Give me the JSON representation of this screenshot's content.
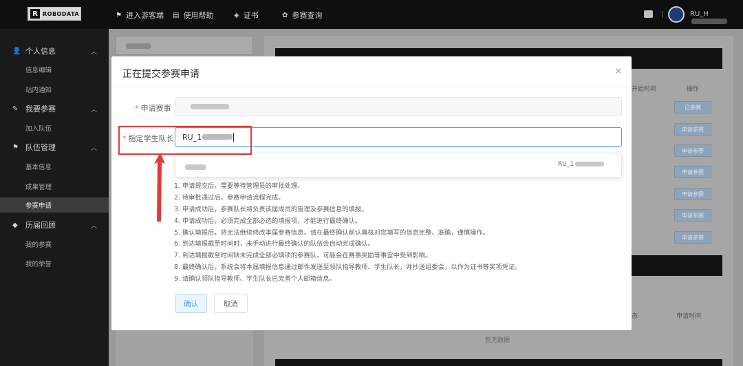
{
  "nav": {
    "logo_letter": "R",
    "logo_text": "ROBODATA",
    "items": [
      {
        "icon": "flag-icon",
        "glyph": "⚑",
        "label": "进入游客端"
      },
      {
        "icon": "book-icon",
        "glyph": "▤",
        "label": "使用帮助"
      },
      {
        "icon": "certificate-icon",
        "glyph": "◈",
        "label": "证书"
      },
      {
        "icon": "trophy-icon",
        "glyph": "✿",
        "label": "参赛查询"
      }
    ],
    "username": "RU_H"
  },
  "sidebar": {
    "groups": [
      {
        "label": "个人信息",
        "icon": "user-icon",
        "glyph": "👤",
        "items": [
          "信息编辑",
          "站内通知"
        ]
      },
      {
        "label": "我要参赛",
        "icon": "pen-icon",
        "glyph": "✎",
        "items": [
          "加入队伍"
        ]
      },
      {
        "label": "队伍管理",
        "icon": "flag-icon",
        "glyph": "⚑",
        "items": [
          "基本信息",
          "成果管理",
          "参赛申请"
        ]
      },
      {
        "label": "历届回顾",
        "icon": "cube-icon",
        "glyph": "◆",
        "items": [
          "我的参赛",
          "我的荣誉"
        ]
      }
    ],
    "active_item": "参赛申请"
  },
  "background": {
    "col_start_time": "开始时间",
    "col_action": "操作",
    "btn_applied": "已参赛",
    "btn_apply": "申请参赛",
    "col_status": "态",
    "col_apply_time": "申请时间",
    "no_data": "暂无数据"
  },
  "modal": {
    "title": "正在提交参赛申请",
    "close": "×",
    "field_competition_label": "申请赛事",
    "field_captain_label": "指定学生队长",
    "field_captain_value": "RU_1",
    "required_mark": "*",
    "dropdown_right": "RU_1",
    "notes": [
      "1. 申请提交后，需要等待管理员的审批处理。",
      "2. 待审批通过后，参赛申请流程完成。",
      "3. 申请成功后，参赛队长将负责该届成员的管理及参赛信息的填报。",
      "4. 申请成功后，必须完成全部必选的填报项，才能进行最终确认。",
      "5. 确认填报后，将无法继续修改本届参赛信息。请在最终确认前认真核对您填写的信息完整、准确，谨慎操作。",
      "6. 到达填报截至时间时，未手动进行最终确认的队伍会自动完成确认。",
      "7. 到达填报截至时间缺未完成全部必填项的参赛队，可能会在赛事奖励等事宜中受到影响。",
      "8. 最终确认后，系统会将本届填报信息通过邮件发送至领队指导教师、学生队长，并抄送组委会，以作为证书等奖项凭证。",
      "9. 请确认领队指导教师、学生队长已完善个人邮箱信息。"
    ],
    "confirm_label": "确认",
    "cancel_label": "取消"
  },
  "colors": {
    "primary": "#409eff",
    "required": "#f56c6c",
    "annotation": "#e53935"
  }
}
